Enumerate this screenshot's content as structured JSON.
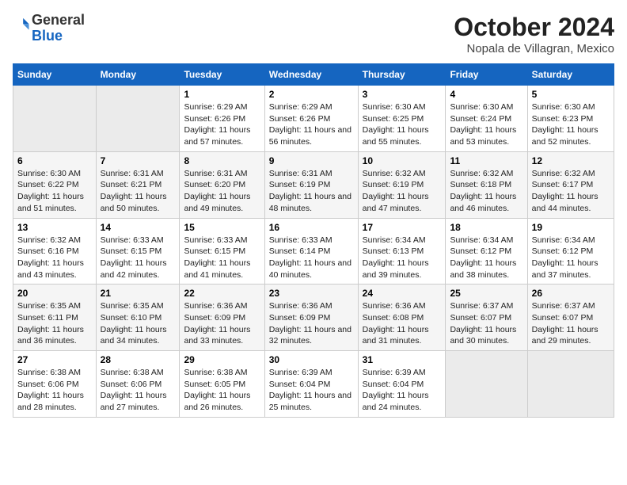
{
  "logo": {
    "general": "General",
    "blue": "Blue"
  },
  "title": "October 2024",
  "subtitle": "Nopala de Villagran, Mexico",
  "headers": [
    "Sunday",
    "Monday",
    "Tuesday",
    "Wednesday",
    "Thursday",
    "Friday",
    "Saturday"
  ],
  "weeks": [
    [
      {
        "day": "",
        "empty": true
      },
      {
        "day": "",
        "empty": true
      },
      {
        "day": "1",
        "sunrise": "Sunrise: 6:29 AM",
        "sunset": "Sunset: 6:26 PM",
        "daylight": "Daylight: 11 hours and 57 minutes."
      },
      {
        "day": "2",
        "sunrise": "Sunrise: 6:29 AM",
        "sunset": "Sunset: 6:26 PM",
        "daylight": "Daylight: 11 hours and 56 minutes."
      },
      {
        "day": "3",
        "sunrise": "Sunrise: 6:30 AM",
        "sunset": "Sunset: 6:25 PM",
        "daylight": "Daylight: 11 hours and 55 minutes."
      },
      {
        "day": "4",
        "sunrise": "Sunrise: 6:30 AM",
        "sunset": "Sunset: 6:24 PM",
        "daylight": "Daylight: 11 hours and 53 minutes."
      },
      {
        "day": "5",
        "sunrise": "Sunrise: 6:30 AM",
        "sunset": "Sunset: 6:23 PM",
        "daylight": "Daylight: 11 hours and 52 minutes."
      }
    ],
    [
      {
        "day": "6",
        "sunrise": "Sunrise: 6:30 AM",
        "sunset": "Sunset: 6:22 PM",
        "daylight": "Daylight: 11 hours and 51 minutes."
      },
      {
        "day": "7",
        "sunrise": "Sunrise: 6:31 AM",
        "sunset": "Sunset: 6:21 PM",
        "daylight": "Daylight: 11 hours and 50 minutes."
      },
      {
        "day": "8",
        "sunrise": "Sunrise: 6:31 AM",
        "sunset": "Sunset: 6:20 PM",
        "daylight": "Daylight: 11 hours and 49 minutes."
      },
      {
        "day": "9",
        "sunrise": "Sunrise: 6:31 AM",
        "sunset": "Sunset: 6:19 PM",
        "daylight": "Daylight: 11 hours and 48 minutes."
      },
      {
        "day": "10",
        "sunrise": "Sunrise: 6:32 AM",
        "sunset": "Sunset: 6:19 PM",
        "daylight": "Daylight: 11 hours and 47 minutes."
      },
      {
        "day": "11",
        "sunrise": "Sunrise: 6:32 AM",
        "sunset": "Sunset: 6:18 PM",
        "daylight": "Daylight: 11 hours and 46 minutes."
      },
      {
        "day": "12",
        "sunrise": "Sunrise: 6:32 AM",
        "sunset": "Sunset: 6:17 PM",
        "daylight": "Daylight: 11 hours and 44 minutes."
      }
    ],
    [
      {
        "day": "13",
        "sunrise": "Sunrise: 6:32 AM",
        "sunset": "Sunset: 6:16 PM",
        "daylight": "Daylight: 11 hours and 43 minutes."
      },
      {
        "day": "14",
        "sunrise": "Sunrise: 6:33 AM",
        "sunset": "Sunset: 6:15 PM",
        "daylight": "Daylight: 11 hours and 42 minutes."
      },
      {
        "day": "15",
        "sunrise": "Sunrise: 6:33 AM",
        "sunset": "Sunset: 6:15 PM",
        "daylight": "Daylight: 11 hours and 41 minutes."
      },
      {
        "day": "16",
        "sunrise": "Sunrise: 6:33 AM",
        "sunset": "Sunset: 6:14 PM",
        "daylight": "Daylight: 11 hours and 40 minutes."
      },
      {
        "day": "17",
        "sunrise": "Sunrise: 6:34 AM",
        "sunset": "Sunset: 6:13 PM",
        "daylight": "Daylight: 11 hours and 39 minutes."
      },
      {
        "day": "18",
        "sunrise": "Sunrise: 6:34 AM",
        "sunset": "Sunset: 6:12 PM",
        "daylight": "Daylight: 11 hours and 38 minutes."
      },
      {
        "day": "19",
        "sunrise": "Sunrise: 6:34 AM",
        "sunset": "Sunset: 6:12 PM",
        "daylight": "Daylight: 11 hours and 37 minutes."
      }
    ],
    [
      {
        "day": "20",
        "sunrise": "Sunrise: 6:35 AM",
        "sunset": "Sunset: 6:11 PM",
        "daylight": "Daylight: 11 hours and 36 minutes."
      },
      {
        "day": "21",
        "sunrise": "Sunrise: 6:35 AM",
        "sunset": "Sunset: 6:10 PM",
        "daylight": "Daylight: 11 hours and 34 minutes."
      },
      {
        "day": "22",
        "sunrise": "Sunrise: 6:36 AM",
        "sunset": "Sunset: 6:09 PM",
        "daylight": "Daylight: 11 hours and 33 minutes."
      },
      {
        "day": "23",
        "sunrise": "Sunrise: 6:36 AM",
        "sunset": "Sunset: 6:09 PM",
        "daylight": "Daylight: 11 hours and 32 minutes."
      },
      {
        "day": "24",
        "sunrise": "Sunrise: 6:36 AM",
        "sunset": "Sunset: 6:08 PM",
        "daylight": "Daylight: 11 hours and 31 minutes."
      },
      {
        "day": "25",
        "sunrise": "Sunrise: 6:37 AM",
        "sunset": "Sunset: 6:07 PM",
        "daylight": "Daylight: 11 hours and 30 minutes."
      },
      {
        "day": "26",
        "sunrise": "Sunrise: 6:37 AM",
        "sunset": "Sunset: 6:07 PM",
        "daylight": "Daylight: 11 hours and 29 minutes."
      }
    ],
    [
      {
        "day": "27",
        "sunrise": "Sunrise: 6:38 AM",
        "sunset": "Sunset: 6:06 PM",
        "daylight": "Daylight: 11 hours and 28 minutes."
      },
      {
        "day": "28",
        "sunrise": "Sunrise: 6:38 AM",
        "sunset": "Sunset: 6:06 PM",
        "daylight": "Daylight: 11 hours and 27 minutes."
      },
      {
        "day": "29",
        "sunrise": "Sunrise: 6:38 AM",
        "sunset": "Sunset: 6:05 PM",
        "daylight": "Daylight: 11 hours and 26 minutes."
      },
      {
        "day": "30",
        "sunrise": "Sunrise: 6:39 AM",
        "sunset": "Sunset: 6:04 PM",
        "daylight": "Daylight: 11 hours and 25 minutes."
      },
      {
        "day": "31",
        "sunrise": "Sunrise: 6:39 AM",
        "sunset": "Sunset: 6:04 PM",
        "daylight": "Daylight: 11 hours and 24 minutes."
      },
      {
        "day": "",
        "empty": true
      },
      {
        "day": "",
        "empty": true
      }
    ]
  ]
}
